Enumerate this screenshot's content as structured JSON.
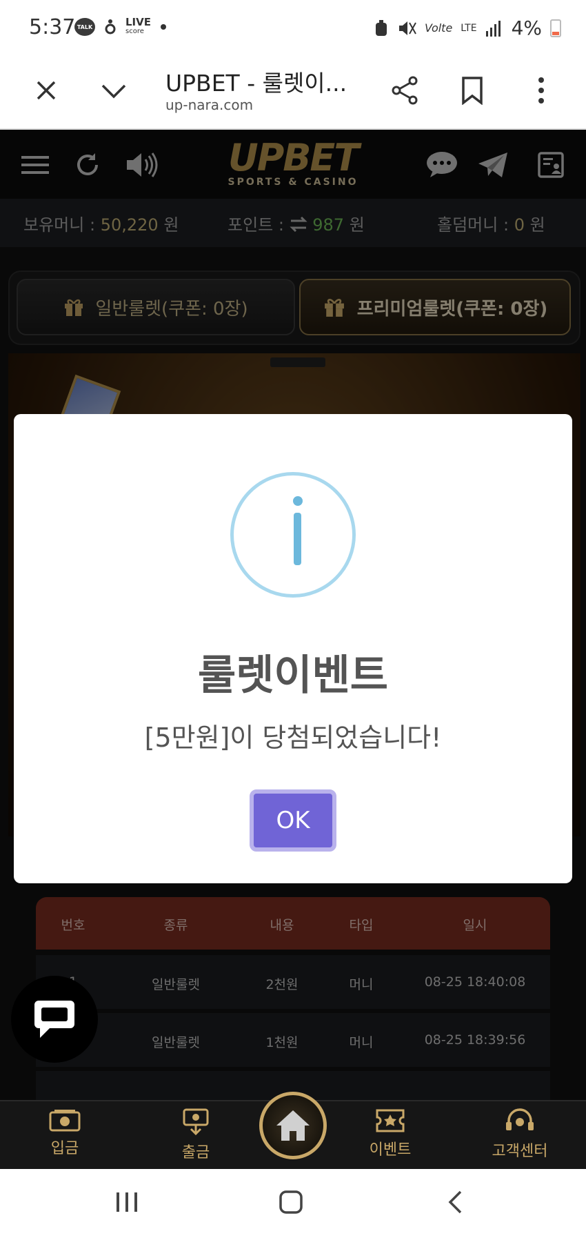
{
  "status_bar": {
    "time": "5:37",
    "talk": "TALK",
    "live": "LIVE",
    "score": "score",
    "volte": "Volte",
    "lte": "LTE",
    "battery": "4%"
  },
  "browser": {
    "page_title": "UPBET - 룰렛이...",
    "url": "up-nara.com"
  },
  "site_header": {
    "logo_main": "UPBET",
    "logo_sub": "SPORTS & CASINO"
  },
  "money_bar": {
    "holding_label": "보유머니 :",
    "holding_value": "50,220",
    "holding_unit": "원",
    "point_label": "포인트 :",
    "point_value": "987",
    "point_unit": "원",
    "holdem_label": "홀덤머니 :",
    "holdem_value": "0",
    "holdem_unit": "원"
  },
  "roulette_tabs": [
    {
      "label": "일반룰렛(쿠폰: 0장)"
    },
    {
      "label": "프리미엄룰렛(쿠폰: 0장)"
    }
  ],
  "dialog": {
    "title": "룰렛이벤트",
    "message": "[5만원]이 당첨되었습니다!",
    "ok_label": "OK"
  },
  "history_table": {
    "headers": [
      "번호",
      "종류",
      "내용",
      "타입",
      "일시"
    ],
    "rows": [
      {
        "no": "1",
        "kind": "일반룰렛",
        "content": "2천원",
        "type": "머니",
        "datetime": "08-25 18:40:08"
      },
      {
        "no": "",
        "kind": "일반룰렛",
        "content": "1천원",
        "type": "머니",
        "datetime": "08-25 18:39:56"
      }
    ]
  },
  "bottom_nav": [
    {
      "label": "입금",
      "icon": "deposit-icon"
    },
    {
      "label": "출금",
      "icon": "withdraw-icon"
    },
    {
      "label": "",
      "icon": "home-icon"
    },
    {
      "label": "이벤트",
      "icon": "event-icon"
    },
    {
      "label": "고객센터",
      "icon": "support-icon"
    }
  ],
  "colors": {
    "accent_gold": "#c9a868",
    "dialog_button": "#7064d6",
    "table_header": "#7e2e22",
    "point_green": "#72c05a"
  }
}
